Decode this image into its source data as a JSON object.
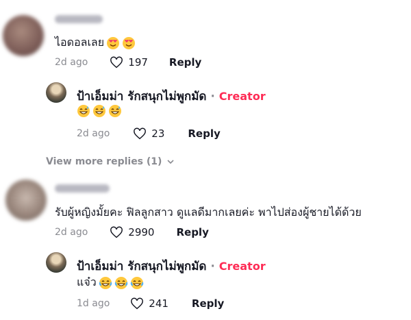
{
  "comments": [
    {
      "text": "ไอดอลเลย",
      "emojis": [
        "love-face",
        "love-face"
      ],
      "time": "2d ago",
      "likes": "197",
      "reply_label": "Reply"
    },
    {
      "username": "ป้าเอ็มม่า รักสนุกไม่พูกมัด",
      "separator": "·",
      "badge": "Creator",
      "emojis": [
        "grin-sweat",
        "grin-sweat",
        "grin-sweat"
      ],
      "time": "2d ago",
      "likes": "23",
      "reply_label": "Reply"
    },
    {
      "text": "รับผู้หญิงมั้ยคะ ฟิลลูกสาว ดูแลดีมากเลยค่ะ พาไปส่องผู้ชายได้ด้วย",
      "time": "2d ago",
      "likes": "2990",
      "reply_label": "Reply"
    },
    {
      "username": "ป้าเอ็มม่า รักสนุกไม่พูกมัด",
      "separator": "·",
      "badge": "Creator",
      "text": "แจ๋ว",
      "emojis": [
        "joy",
        "joy",
        "joy"
      ],
      "time": "1d ago",
      "likes": "241",
      "reply_label": "Reply"
    }
  ],
  "view_more": "View more replies (1)",
  "colors": {
    "creator": "#fe2c55",
    "muted": "#8a8b91",
    "text": "#161823"
  }
}
